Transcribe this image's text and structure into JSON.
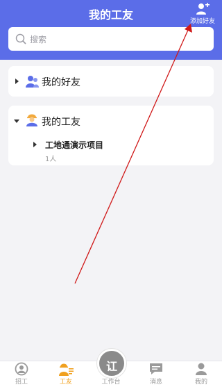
{
  "header": {
    "title": "我的工友",
    "add_friend_label": "添加好友"
  },
  "search": {
    "placeholder": "搜索"
  },
  "groups": [
    {
      "label": "我的好友",
      "expanded": false
    },
    {
      "label": "我的工友",
      "expanded": true,
      "items": [
        {
          "name": "工地通演示项目",
          "count": "1人"
        }
      ]
    }
  ],
  "tabbar": {
    "tabs": [
      {
        "label": "招工",
        "icon": "recruit-icon",
        "active": false
      },
      {
        "label": "工友",
        "icon": "workmate-icon",
        "active": true
      },
      {
        "label": "工作台",
        "icon": "workbench-icon",
        "active": false,
        "glyph": "讧"
      },
      {
        "label": "消息",
        "icon": "message-icon",
        "active": false
      },
      {
        "label": "我的",
        "icon": "profile-icon",
        "active": false
      }
    ]
  },
  "colors": {
    "header": "#5b6de8",
    "active_tab": "#f0a01e",
    "annotation_arrow": "#d01818"
  }
}
